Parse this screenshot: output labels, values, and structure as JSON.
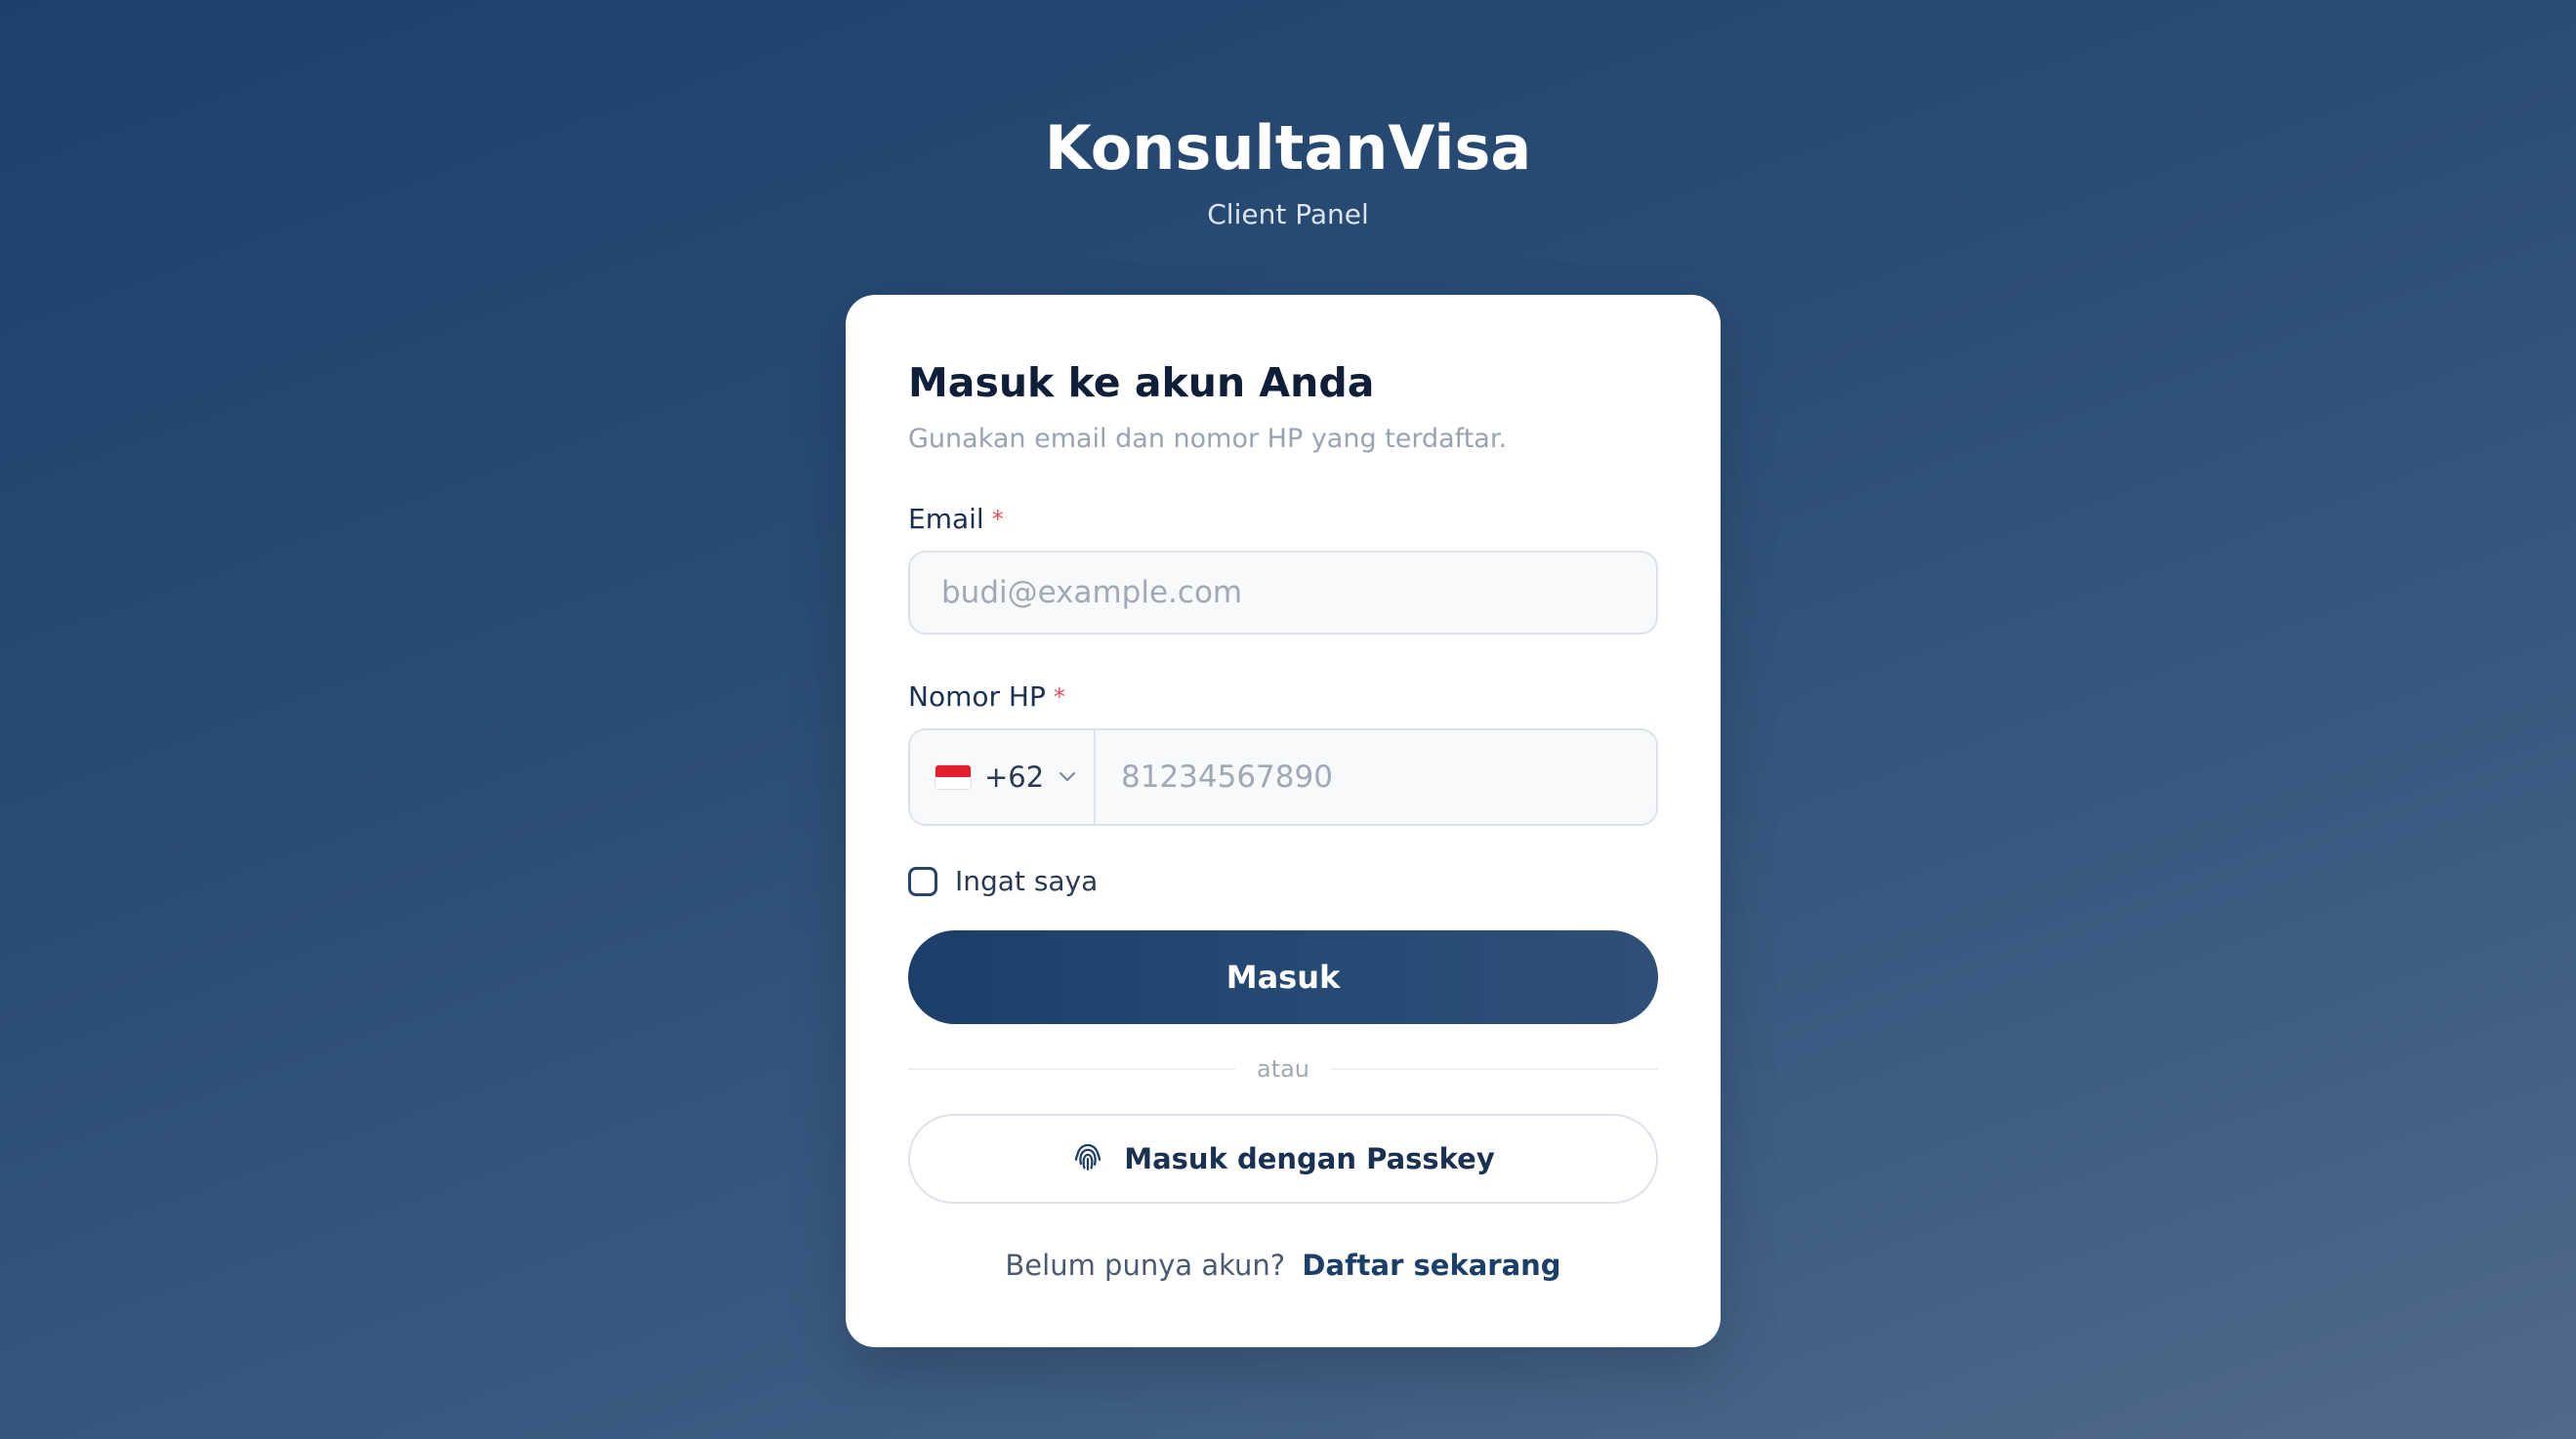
{
  "brand": {
    "title": "KonsultanVisa",
    "subtitle": "Client Panel"
  },
  "login_card": {
    "title": "Masuk ke akun Anda",
    "subtitle": "Gunakan email dan nomor HP yang terdaftar.",
    "email": {
      "label": "Email",
      "required_mark": "*",
      "placeholder": "budi@example.com",
      "value": ""
    },
    "phone": {
      "label": "Nomor HP",
      "required_mark": "*",
      "country_flag_icon": "indonesia-flag-icon",
      "country_code": "+62",
      "placeholder": "81234567890",
      "value": ""
    },
    "remember_me": {
      "label": "Ingat saya",
      "checked": false
    },
    "submit_label": "Masuk",
    "divider_text": "atau",
    "passkey": {
      "icon": "fingerprint-icon",
      "label": "Masuk dengan Passkey"
    },
    "signup": {
      "prompt": "Belum punya akun?",
      "link_label": "Daftar sekarang"
    }
  },
  "colors": {
    "primary": "#1b3f69",
    "required": "#e0505a",
    "background": "#2a4d74"
  }
}
